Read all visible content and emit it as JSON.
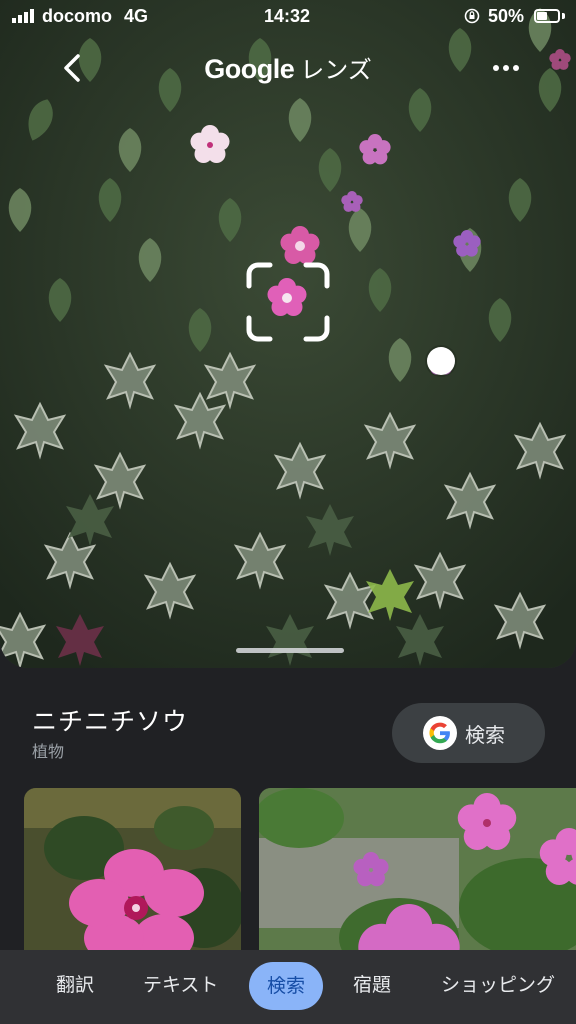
{
  "status_bar": {
    "carrier": "docomo",
    "network": "4G",
    "time": "14:32",
    "battery": "50%",
    "battery_level": 0.5
  },
  "header": {
    "title_brand": "Google",
    "title_suffix": "レンズ",
    "back_icon": "chevron-left-icon",
    "more_icon": "more-horiz-icon"
  },
  "result": {
    "name": "ニチニチソウ",
    "category": "植物",
    "search_label": "検索"
  },
  "tabs": [
    {
      "label": "翻訳",
      "active": false
    },
    {
      "label": "テキスト",
      "active": false
    },
    {
      "label": "検索",
      "active": true
    },
    {
      "label": "宿題",
      "active": false
    },
    {
      "label": "ショッピング",
      "active": false
    }
  ],
  "colors": {
    "background": "#202124",
    "tab_bar": "#303134",
    "active_tab": "#8ab4f8",
    "active_tab_text": "#174ea6",
    "flower_pink": "#e056b8"
  }
}
